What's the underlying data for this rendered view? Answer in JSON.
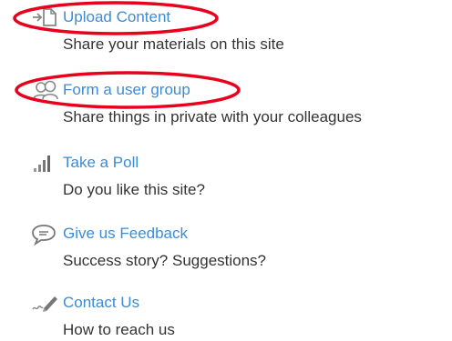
{
  "items": [
    {
      "icon": "upload-icon",
      "label": "Upload Content",
      "description": "Share your materials on this site"
    },
    {
      "icon": "user-group-icon",
      "label": "Form a user group",
      "description": "Share things in private with your colleagues"
    },
    {
      "icon": "poll-bars-icon",
      "label": "Take a Poll",
      "description": "Do you like this site?"
    },
    {
      "icon": "speech-bubble-icon",
      "label": "Give us Feedback",
      "description": "Success story? Suggestions?"
    },
    {
      "icon": "pen-icon",
      "label": "Contact Us",
      "description": "How to reach us"
    }
  ],
  "colors": {
    "link": "#3d8bd6",
    "text": "#333333",
    "icon": "#888888",
    "annotation": "#e8001c"
  }
}
